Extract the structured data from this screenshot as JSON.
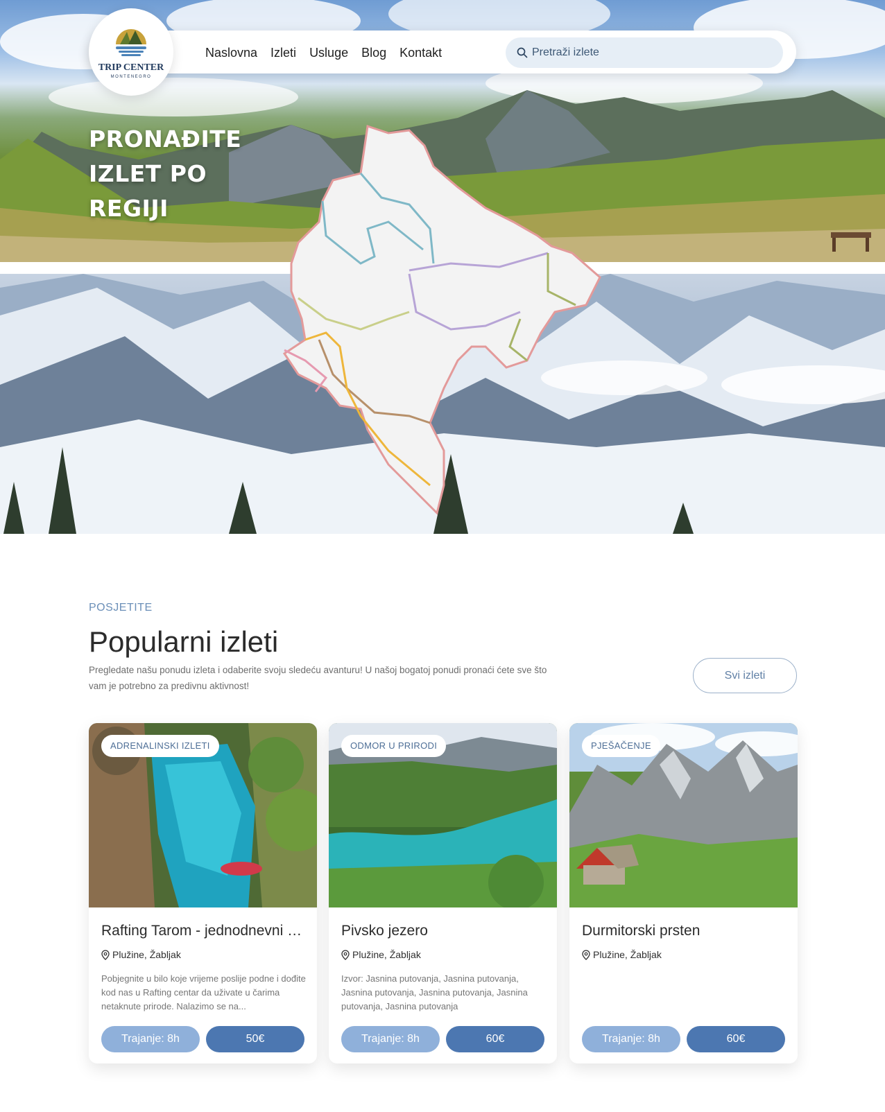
{
  "brand": {
    "name": "TRIP CENTER",
    "sub": "MONTENEGRO"
  },
  "nav": {
    "items": [
      "Naslovna",
      "Izleti",
      "Usluge",
      "Blog",
      "Kontakt"
    ]
  },
  "search": {
    "placeholder": "Pretraži izlete"
  },
  "hero": {
    "title_lines": [
      "PRONAĐITE",
      "IZLET PO",
      "REGIJI"
    ]
  },
  "popular": {
    "eyebrow": "POSJETITE",
    "title": "Popularni izleti",
    "description": "Pregledate našu ponudu izleta i odaberite svoju sledeću avanturu! U našoj bogatoj ponudi pronaći ćete sve što vam je potrebno za predivnu aktivnost!",
    "all_button": "Svi izleti"
  },
  "cards": [
    {
      "badge": "ADRENALINSKI IZLETI",
      "title": "Rafting Tarom - jednodnevni rafting",
      "location": "Plužine, Žabljak",
      "description": "Pobjegnite u bilo koje vrijeme poslije podne i dođite kod nas u Rafting centar da uživate u čarima netaknute prirode.  Nalazimo se na...",
      "duration": "Trajanje: 8h",
      "price": "50€"
    },
    {
      "badge": "ODMOR U PRIRODI",
      "title": "Pivsko jezero",
      "location": "Plužine, Žabljak",
      "description": "Izvor: Jasnina putovanja, Jasnina putovanja, Jasnina putovanja, Jasnina putovanja, Jasnina putovanja, Jasnina putovanja",
      "duration": "Trajanje: 8h",
      "price": "60€"
    },
    {
      "badge": "PJEŠAČENJE",
      "title": "Durmitorski prsten",
      "location": "Plužine, Žabljak",
      "description": "",
      "duration": "Trajanje: 8h",
      "price": "60€"
    }
  ],
  "colors": {
    "accent": "#4c77b1",
    "accent_light": "#8fb0da",
    "eyebrow": "#6b8fb8"
  }
}
